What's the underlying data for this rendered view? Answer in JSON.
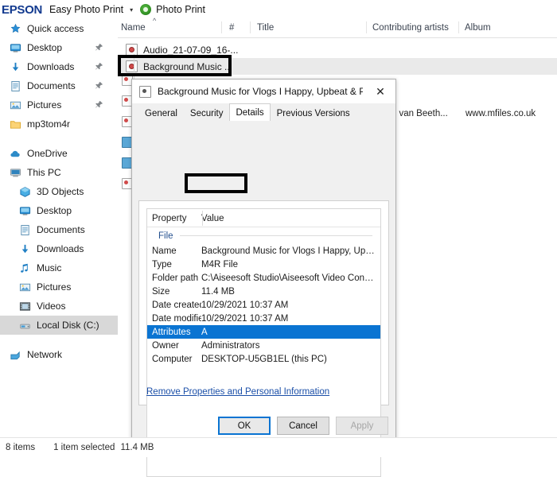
{
  "epson_bar": {
    "logo": "EPSON",
    "app_label": "Easy Photo Print",
    "caret": "▾",
    "photo_print_icon": "photo-print-icon",
    "photo_print_label": "Photo Print"
  },
  "sidebar": {
    "items": [
      {
        "label": "Quick access",
        "icon": "star-icon",
        "pinned": false,
        "indent": false,
        "selected": false
      },
      {
        "label": "Desktop",
        "icon": "monitor-icon",
        "pinned": true,
        "indent": false,
        "selected": false
      },
      {
        "label": "Downloads",
        "icon": "download-arrow-icon",
        "pinned": true,
        "indent": false,
        "selected": false
      },
      {
        "label": "Documents",
        "icon": "document-icon",
        "pinned": true,
        "indent": false,
        "selected": false
      },
      {
        "label": "Pictures",
        "icon": "picture-icon",
        "pinned": true,
        "indent": false,
        "selected": false
      },
      {
        "label": "mp3tom4r",
        "icon": "folder-icon",
        "pinned": false,
        "indent": false,
        "selected": false
      },
      {
        "label": "OneDrive",
        "icon": "cloud-icon",
        "pinned": false,
        "indent": false,
        "selected": false
      },
      {
        "label": "This PC",
        "icon": "computer-icon",
        "pinned": false,
        "indent": false,
        "selected": false
      },
      {
        "label": "3D Objects",
        "icon": "3d-objects-icon",
        "pinned": false,
        "indent": true,
        "selected": false
      },
      {
        "label": "Desktop",
        "icon": "monitor-icon",
        "pinned": false,
        "indent": true,
        "selected": false
      },
      {
        "label": "Documents",
        "icon": "document-icon",
        "pinned": false,
        "indent": true,
        "selected": false
      },
      {
        "label": "Downloads",
        "icon": "download-arrow-icon",
        "pinned": false,
        "indent": true,
        "selected": false
      },
      {
        "label": "Music",
        "icon": "music-note-icon",
        "pinned": false,
        "indent": true,
        "selected": false
      },
      {
        "label": "Pictures",
        "icon": "picture-icon",
        "pinned": false,
        "indent": true,
        "selected": false
      },
      {
        "label": "Videos",
        "icon": "video-icon",
        "pinned": false,
        "indent": true,
        "selected": false
      },
      {
        "label": "Local Disk (C:)",
        "icon": "hard-disk-icon",
        "pinned": false,
        "indent": true,
        "selected": true
      },
      {
        "label": "Network",
        "icon": "network-icon",
        "pinned": false,
        "indent": false,
        "selected": false
      }
    ]
  },
  "file_list": {
    "columns": [
      {
        "label": "Name",
        "sorted": true,
        "sort_mark": "^"
      },
      {
        "label": "#",
        "sorted": false
      },
      {
        "label": "Title",
        "sorted": false
      },
      {
        "label": "Contributing artists",
        "sorted": false
      },
      {
        "label": "Album",
        "sorted": false
      }
    ],
    "rows": [
      {
        "name": "Audio_21-07-09_16-...",
        "selected": false
      },
      {
        "name": "Background Music ...",
        "selected": true
      }
    ],
    "background_meta": [
      {
        "text": "wig van Beeth..."
      },
      {
        "text": "www.mfiles.co.uk"
      }
    ]
  },
  "dialog": {
    "title": "Background Music for Vlogs I Happy, Upbeat & Perfect...",
    "close_icon": "close-icon",
    "tabs": [
      {
        "label": "General",
        "active": false
      },
      {
        "label": "Security",
        "active": false
      },
      {
        "label": "Details",
        "active": true
      },
      {
        "label": "Previous Versions",
        "active": false
      }
    ],
    "table_headers": {
      "property": "Property",
      "value": "Value"
    },
    "group_label": "File",
    "properties": [
      {
        "key": "Name",
        "value": "Background Music for Vlogs I Happy, Upb...",
        "highlighted": false
      },
      {
        "key": "Type",
        "value": "M4R File",
        "highlighted": false
      },
      {
        "key": "Folder path",
        "value": "C:\\Aiseesoft Studio\\Aiseesoft Video Conve...",
        "highlighted": false
      },
      {
        "key": "Size",
        "value": "11.4 MB",
        "highlighted": false
      },
      {
        "key": "Date created",
        "value": "10/29/2021 10:37 AM",
        "highlighted": false
      },
      {
        "key": "Date modified",
        "value": "10/29/2021 10:37 AM",
        "highlighted": false
      },
      {
        "key": "Attributes",
        "value": "A",
        "highlighted": true
      },
      {
        "key": "Owner",
        "value": "Administrators",
        "highlighted": false
      },
      {
        "key": "Computer",
        "value": "DESKTOP-U5GB1EL (this PC)",
        "highlighted": false
      }
    ],
    "remove_link": "Remove Properties and Personal Information",
    "buttons": [
      {
        "label": "OK",
        "state": "default"
      },
      {
        "label": "Cancel",
        "state": "normal"
      },
      {
        "label": "Apply",
        "state": "disabled"
      }
    ]
  },
  "status_bar": {
    "items_count": "8 items",
    "selection": "1 item selected",
    "size": "11.4 MB"
  },
  "colors": {
    "epson_blue": "#123a8f",
    "selection_blue": "#0a74d2",
    "link_blue": "#1b4fa8",
    "annotation_black": "#000000",
    "row_selected_gray": "#eaeaea"
  }
}
